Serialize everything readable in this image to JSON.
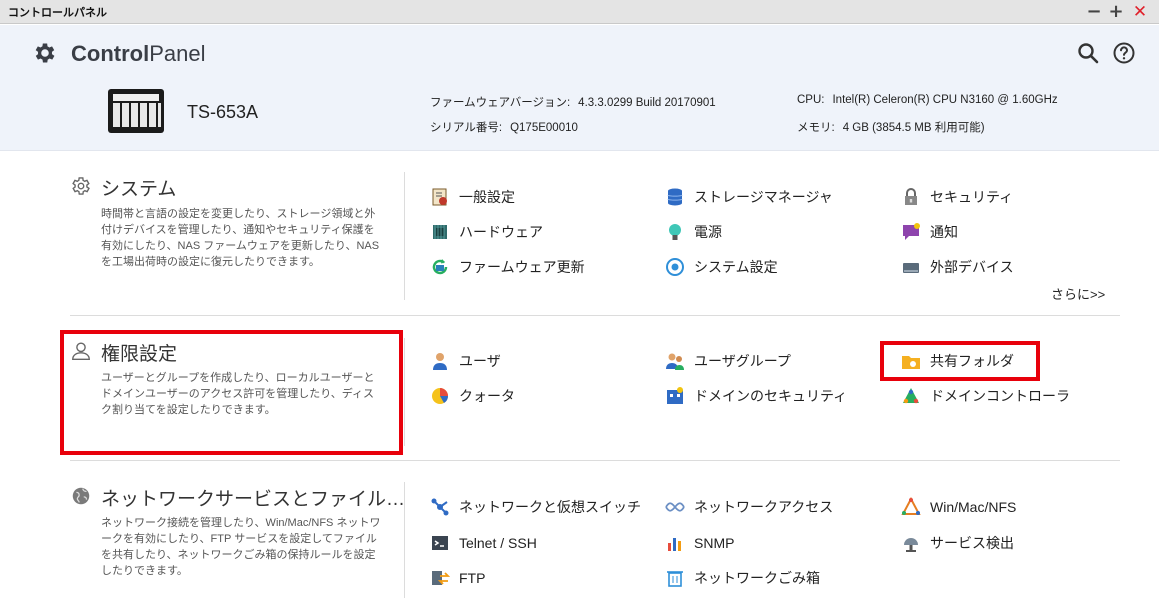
{
  "window": {
    "title": "コントロールパネル",
    "min": "−",
    "max": "+",
    "close": "✕"
  },
  "header": {
    "app_title_bold": "Control",
    "app_title_light": "Panel",
    "model": "TS-653A",
    "firmware_label": "ファームウェアバージョン:",
    "firmware_value": "4.3.3.0299 Build 20170901",
    "serial_label": "シリアル番号:",
    "serial_value": "Q175E00010",
    "cpu_label": "CPU:",
    "cpu_value": "Intel(R) Celeron(R) CPU N3160 @ 1.60GHz",
    "memory_label": "メモリ:",
    "memory_value": "4 GB (3854.5 MB 利用可能)"
  },
  "sections": {
    "system": {
      "title": "システム",
      "description": "時間帯と言語の設定を変更したり、ストレージ領域と外付けデバイスを管理したり、通知やセキュリティ保護を有効にしたり、NAS ファームウェアを更新したり、NAS を工場出荷時の設定に復元したりできます。",
      "items": [
        "一般設定",
        "ストレージマネージャ",
        "セキュリティ",
        "ハードウェア",
        "電源",
        "通知",
        "ファームウェア更新",
        "システム設定",
        "外部デバイス"
      ],
      "more": "さらに>>"
    },
    "privilege": {
      "title": "権限設定",
      "description": "ユーザーとグループを作成したり、ローカルユーザーとドメインユーザーのアクセス許可を管理したり、ディスク割り当てを設定したりできます。",
      "items": [
        "ユーザ",
        "ユーザグループ",
        "共有フォルダ",
        "クォータ",
        "ドメインのセキュリティ",
        "ドメインコントローラ"
      ]
    },
    "network": {
      "title": "ネットワークサービスとファイル…",
      "description": "ネットワーク接続を管理したり、Win/Mac/NFS ネットワークを有効にしたり、FTP サービスを設定してファイルを共有したり、ネットワークごみ箱の保持ルールを設定したりできます。",
      "items": [
        "ネットワークと仮想スイッチ",
        "ネットワークアクセス",
        "Win/Mac/NFS",
        "Telnet / SSH",
        "SNMP",
        "サービス検出",
        "FTP",
        "ネットワークごみ箱"
      ]
    }
  },
  "colors": {
    "header_bg": "#eff3fa",
    "highlight": "#e8000b"
  }
}
